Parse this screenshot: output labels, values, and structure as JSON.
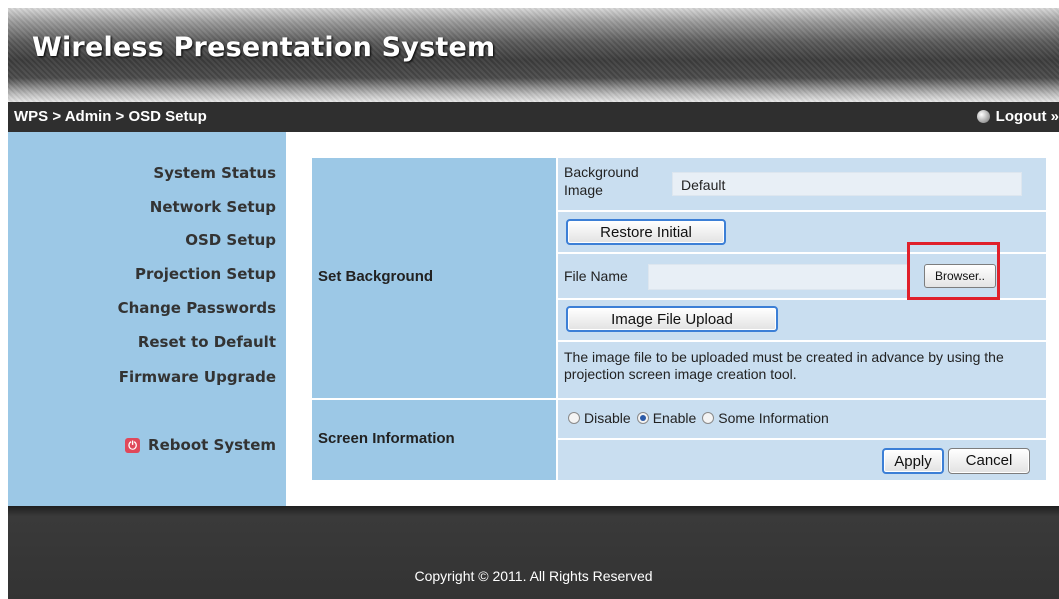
{
  "header": {
    "title": "Wireless Presentation System"
  },
  "breadcrumb": {
    "text": "WPS > Admin > OSD Setup",
    "logout_label": "Logout »"
  },
  "sidebar": {
    "items": [
      {
        "label": "System Status"
      },
      {
        "label": "Network Setup"
      },
      {
        "label": "OSD Setup"
      },
      {
        "label": "Projection Setup"
      },
      {
        "label": "Change Passwords"
      },
      {
        "label": "Reset to Default"
      },
      {
        "label": "Firmware Upgrade"
      }
    ],
    "reboot_label": "Reboot System"
  },
  "form": {
    "set_background": {
      "label": "Set Background",
      "background_image_label": "Background Image",
      "background_image_value": "Default",
      "restore_button": "Restore Initial",
      "file_name_label": "File Name",
      "file_name_value": "",
      "browse_button": "Browser..",
      "upload_button": "Image File Upload",
      "hint": "The image file to be uploaded must be created in advance by using the projection screen image creation tool."
    },
    "screen_information": {
      "label": "Screen Information",
      "options": [
        {
          "label": "Disable",
          "checked": false
        },
        {
          "label": "Enable",
          "checked": true
        },
        {
          "label": "Some Information",
          "checked": false
        }
      ],
      "apply_button": "Apply",
      "cancel_button": "Cancel"
    }
  },
  "footer": {
    "copyright": "Copyright © 2011. All Rights Reserved"
  },
  "colors": {
    "sidebar_bg": "#9cc8e6",
    "value_cell_bg": "#c9def0",
    "dark_bar": "#2f2f2f",
    "highlight": "#e0202a"
  }
}
